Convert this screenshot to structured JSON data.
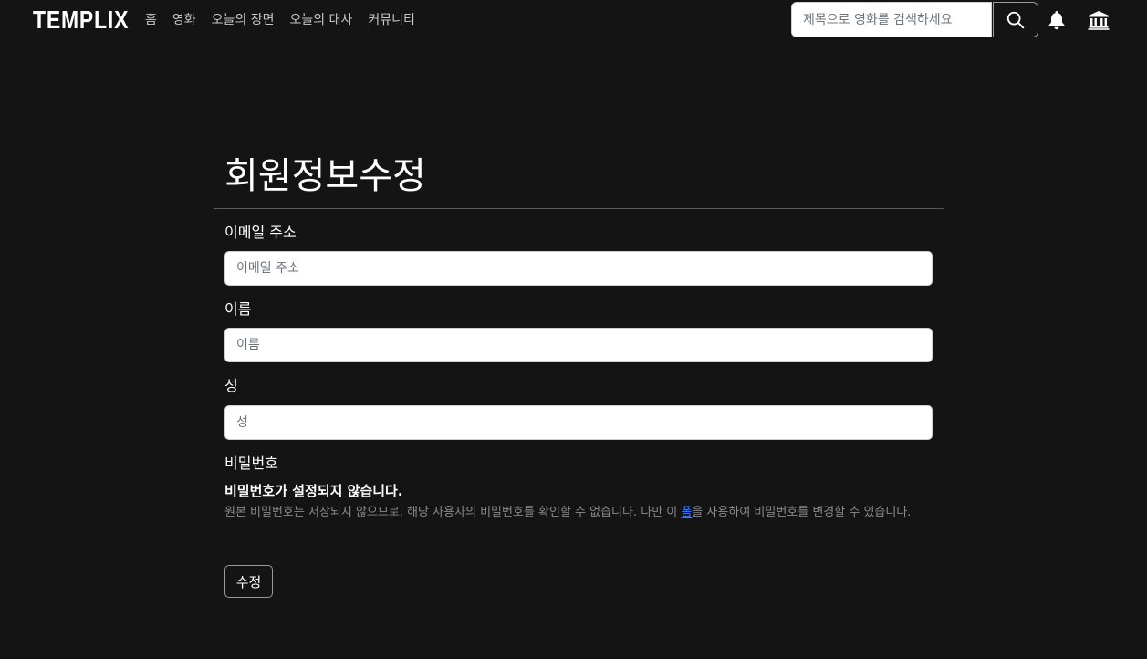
{
  "navbar": {
    "logo": "TEMPLIX",
    "links": [
      "홈",
      "영화",
      "오늘의 장면",
      "오늘의 대사",
      "커뮤니티"
    ],
    "search": {
      "placeholder": "제목으로 영화를 검색하세요",
      "value": ""
    },
    "icons": {
      "search": "search-icon",
      "bell": "bell-icon",
      "museum": "bank-icon"
    }
  },
  "form": {
    "title": "회원정보수정",
    "fields": [
      {
        "label": "이메일 주소",
        "placeholder": "이메일 주소",
        "value": ""
      },
      {
        "label": "이름",
        "placeholder": "이름",
        "value": ""
      },
      {
        "label": "성",
        "placeholder": "성",
        "value": ""
      }
    ],
    "password": {
      "label": "비밀번호",
      "notice": "비밀번호가 설정되지 않습니다.",
      "help_before": "원본 비밀번호는 저장되지 않으므로, 해당 사용자의 비밀번호를 확인할 수 없습니다. 다만 이 ",
      "help_link": "폼",
      "help_after": "을 사용하여 비밀번호를 변경할 수 있습니다."
    },
    "submit_label": "수정"
  },
  "colors": {
    "background": "#141414",
    "text": "#ffffff",
    "muted": "#8a8a8a",
    "link": "#3a7bff"
  }
}
